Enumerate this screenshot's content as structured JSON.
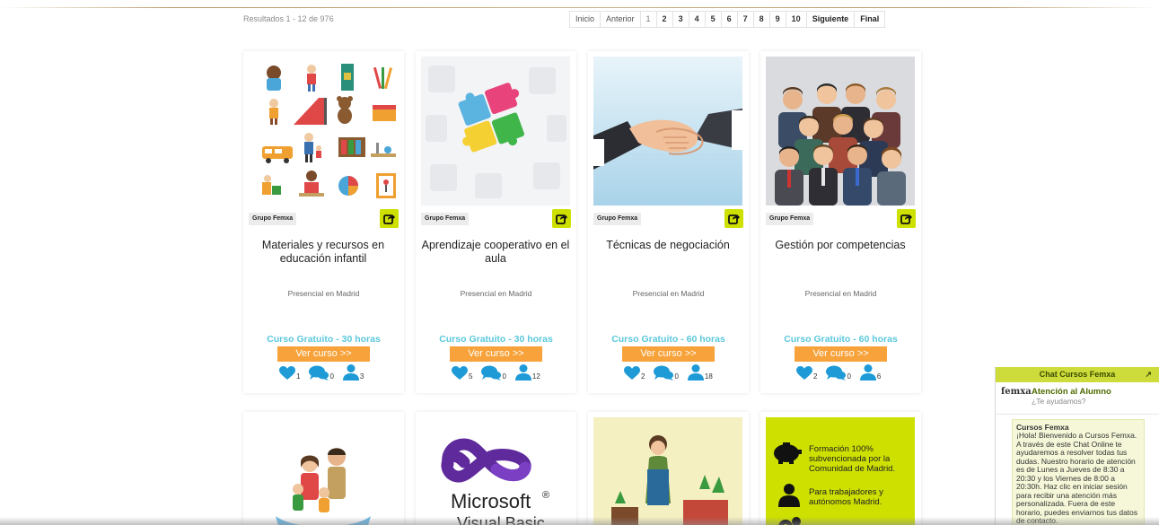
{
  "results": "Resultados 1 - 12 de 976",
  "pagination": {
    "first": "Inicio",
    "prev": "Anterior",
    "pages": [
      "1",
      "2",
      "3",
      "4",
      "5",
      "6",
      "7",
      "8",
      "9",
      "10"
    ],
    "next": "Siguiente",
    "last": "Final"
  },
  "courses": [
    {
      "provider": "Grupo Femxa",
      "title": "Materiales y recursos en educación infantil",
      "mode": "Presencial en Madrid",
      "price": "Curso Gratuito - 30 horas",
      "cta": "Ver curso >>",
      "likes": "1",
      "comments": "0",
      "students": "3"
    },
    {
      "provider": "Grupo Femxa",
      "title": "Aprendizaje cooperativo en el aula",
      "mode": "Presencial en Madrid",
      "price": "Curso Gratuito - 30 horas",
      "cta": "Ver curso >>",
      "likes": "5",
      "comments": "0",
      "students": "12"
    },
    {
      "provider": "Grupo Femxa",
      "title": "Técnicas de negociación",
      "mode": "Presencial en Madrid",
      "price": "Curso Gratuito - 60 horas",
      "cta": "Ver curso >>",
      "likes": "2",
      "comments": "0",
      "students": "18"
    },
    {
      "provider": "Grupo Femxa",
      "title": "Gestión por competencias",
      "mode": "Presencial en Madrid",
      "price": "Curso Gratuito - 60 horas",
      "cta": "Ver curso >>",
      "likes": "2",
      "comments": "0",
      "students": "6"
    }
  ],
  "row2": {
    "ms_name": "Microsoft",
    "ms_reg": "®",
    "ms_product": "Visual Basic",
    "promo": [
      "Formación 100% subvencionada por la Comunidad de Madrid.",
      "Para trabajadores y autónomos Madrid."
    ]
  },
  "chat": {
    "title": "Chat Cursos Femxa",
    "expand": "↗",
    "logo": "femxa",
    "agent": "Atención al Alumno",
    "prompt": "¿Te ayudamos?",
    "sender": "Cursos Femxa",
    "message": "¡Hola! Bienvenido a Cursos Femxa. A través de este Chat Online te ayudaremos a resolver todas tus dudas. Nuestro horario de atención es de Lunes a Jueves de 8:30 a 20:30 y los Viernes de 8:00 a 20:30h. Haz clic en iniciar sesión para recibir una atención más personalizada. Fuera de este horario, puedes enviarnos tus datos de contacto."
  },
  "colors": {
    "accent_green": "#cde000",
    "cta_orange": "#f7a23a",
    "price_cyan": "#5bc8dc",
    "stat_blue": "#1e9bd7"
  }
}
